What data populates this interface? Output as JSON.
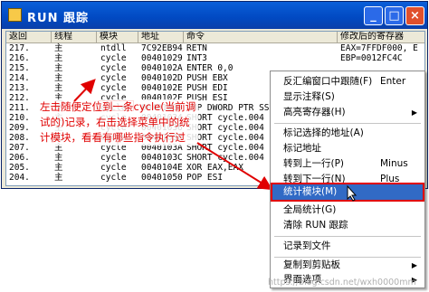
{
  "window": {
    "title": "RUN 跟踪",
    "buttons": {
      "minimize": "_",
      "maximize": "□",
      "close": "×"
    }
  },
  "table": {
    "headers": [
      "返回",
      "线程",
      "模块",
      "地址",
      "命令",
      "修改后的寄存器"
    ],
    "rows": [
      [
        "217.",
        "主",
        "ntdll",
        "7C92EB94",
        "RETN",
        "EAX=7FFDF000, E"
      ],
      [
        "216.",
        "主",
        "cycle",
        "00401029",
        "INT3",
        "EBP=0012FC4C"
      ],
      [
        "215.",
        "主",
        "cycle",
        "0040102A",
        "ENTER 0,0",
        ""
      ],
      [
        "214.",
        "主",
        "cycle",
        "0040102D",
        "PUSH EBX",
        ""
      ],
      [
        "213.",
        "主",
        "cycle",
        "0040102E",
        "PUSH EDI",
        ""
      ],
      [
        "212.",
        "主",
        "cycle",
        "0040102F",
        "PUSH ESI",
        ""
      ],
      [
        "211.",
        "主",
        "cycle",
        "00401030",
        "CMP DWORD PTR SS:[",
        ""
      ],
      [
        "210.",
        "主",
        "cycle",
        "00401034",
        "SHORT cycle.004",
        ""
      ],
      [
        "209.",
        "主",
        "cycle",
        "00401036",
        "SHORT cycle.004",
        ""
      ],
      [
        "208.",
        "主",
        "cycle",
        "00401038",
        "SHORT cycle.004",
        ""
      ],
      [
        "207.",
        "主",
        "cycle",
        "0040103A",
        "SHORT cycle.004",
        ""
      ],
      [
        "206.",
        "主",
        "cycle",
        "0040103C",
        "SHORT cycle.004",
        ""
      ],
      [
        "205.",
        "主",
        "cycle",
        "0040104E",
        "XOR EAX,EAX",
        ""
      ],
      [
        "204.",
        "主",
        "cycle",
        "00401050",
        "POP ESI",
        ""
      ]
    ]
  },
  "annotation": "左击随便定位到一条cycle(当前调试的)记录，右击选择菜单中的统计模块，看看有哪些指令执行过",
  "context_menu": {
    "items": [
      {
        "label": "反汇编窗口中跟随(F)",
        "shortcut": "Enter"
      },
      {
        "label": "显示注释(S)",
        "shortcut": ""
      },
      {
        "label": "高亮寄存器(H)",
        "shortcut": "",
        "submenu": true
      },
      {
        "label": "标记选择的地址(A)",
        "shortcut": ""
      },
      {
        "label": "标记地址",
        "shortcut": ""
      },
      {
        "label": "转到上一行(P)",
        "shortcut": "Minus"
      },
      {
        "label": "转到下一行(N)",
        "shortcut": "Plus"
      },
      {
        "label": "统计模块(M)",
        "shortcut": "",
        "selected": true
      },
      {
        "label": "全局统计(G)",
        "shortcut": ""
      },
      {
        "label": "清除 RUN 跟踪",
        "shortcut": ""
      },
      {
        "label": "记录到文件",
        "shortcut": ""
      },
      {
        "label": "复制到剪贴板",
        "shortcut": "",
        "submenu": true
      },
      {
        "label": "界面选项",
        "shortcut": "",
        "submenu": true
      }
    ]
  },
  "watermark": "https://blog.csdn.net/wxh0000mm",
  "colors": {
    "title_bar": "#0149c2",
    "selection": "#316ac5",
    "annotation": "#e00000",
    "close_button": "#e0502c"
  }
}
